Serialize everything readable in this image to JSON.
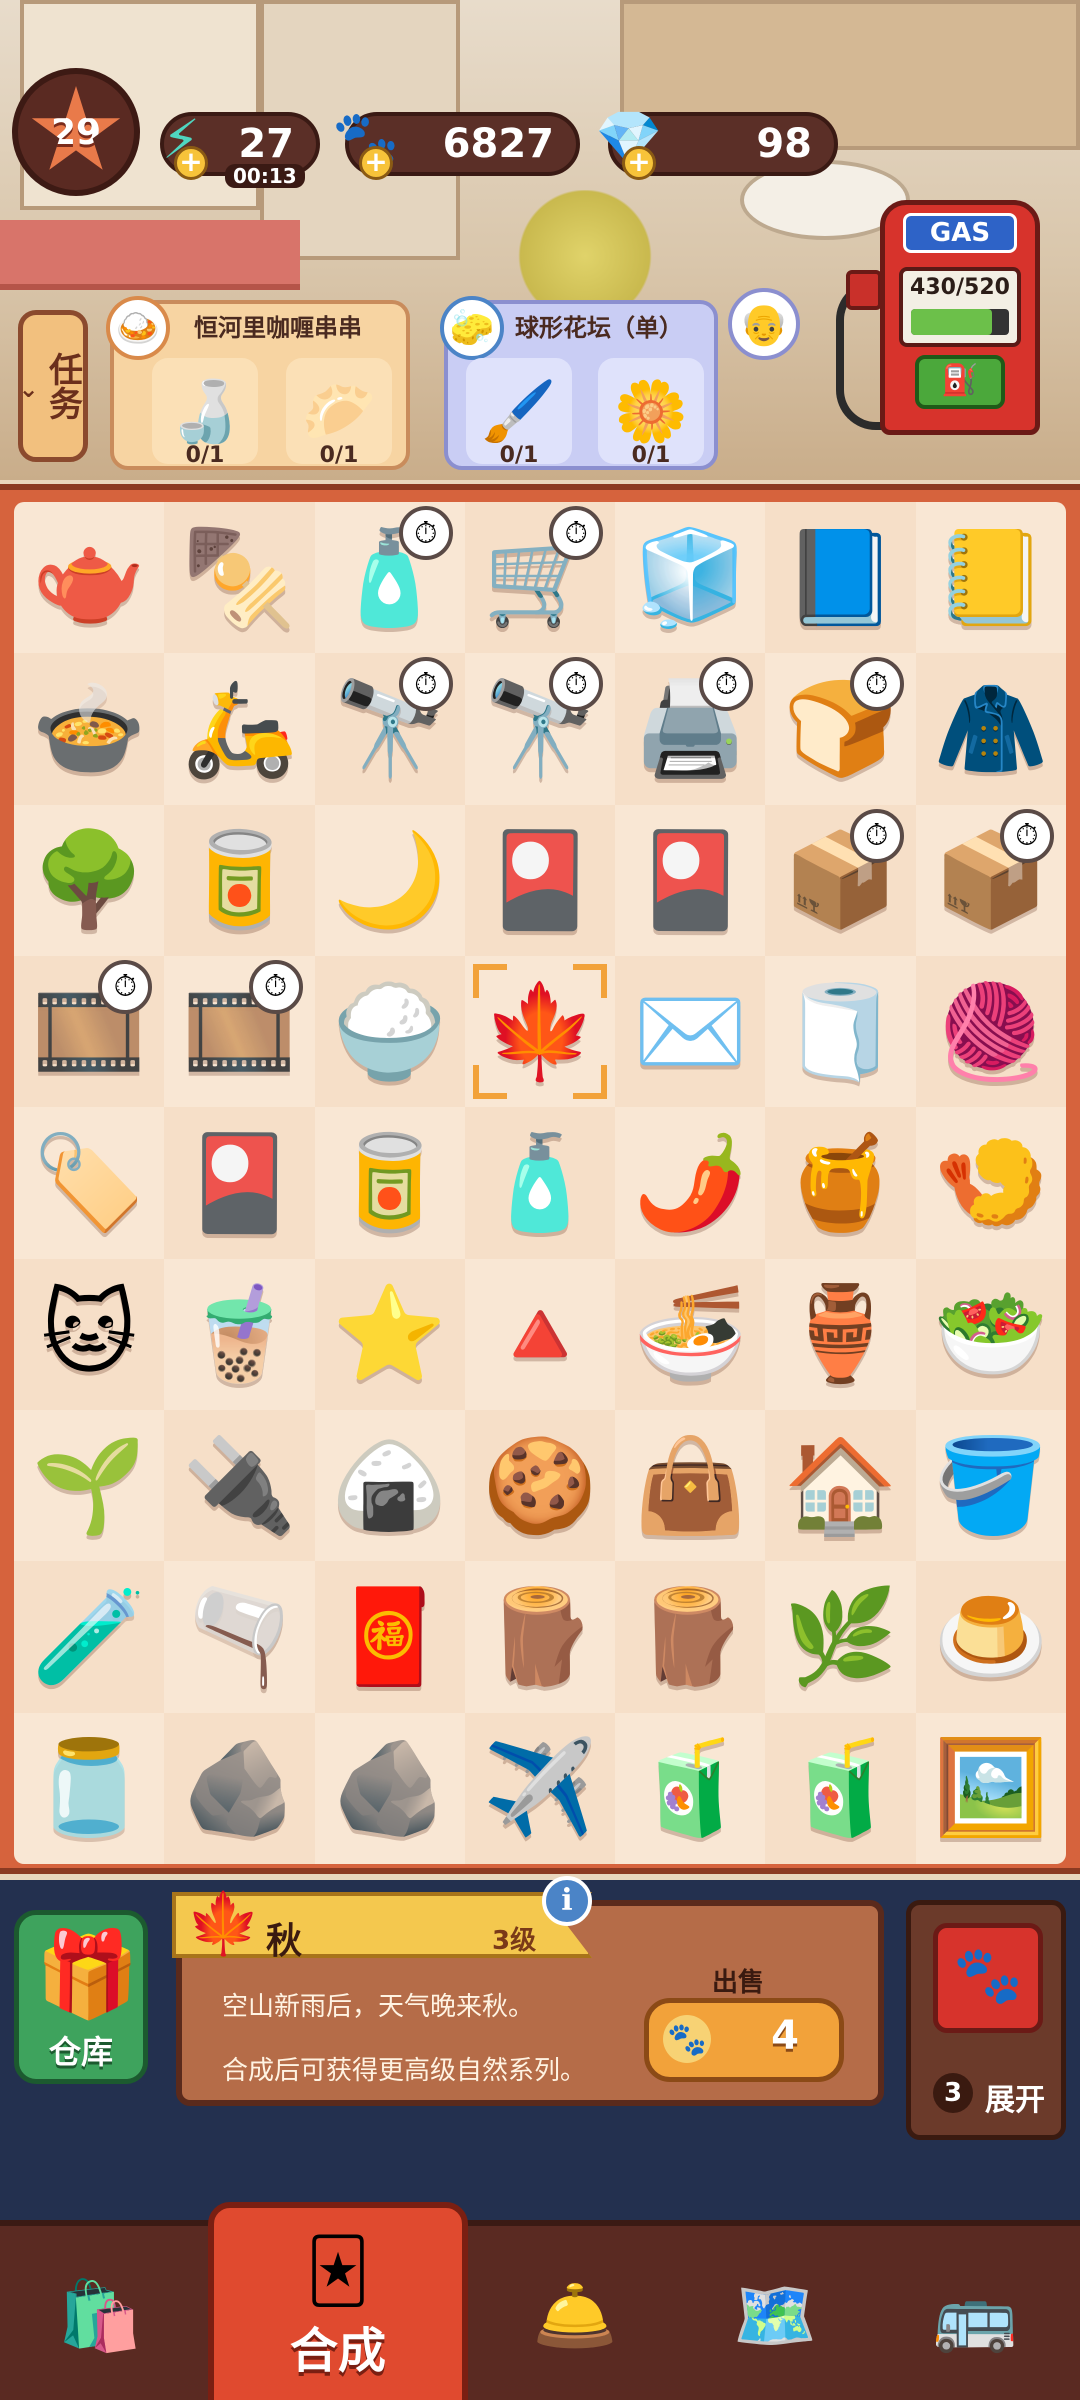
{
  "hud": {
    "level": "29",
    "energy": "27",
    "energy_timer": "00:13",
    "coins": "6827",
    "gems": "98",
    "gas_sign": "GAS",
    "gas_value": "430/520",
    "gas_fill": 0.83
  },
  "tasks": {
    "tab_label": "任务",
    "cards": [
      {
        "title": "恒河里咖喱串串",
        "avatar": "🍛",
        "reqs": [
          {
            "icon": "🍶",
            "count": "0/1"
          },
          {
            "icon": "🥟",
            "count": "0/1"
          }
        ]
      },
      {
        "title": "球形花坛（单）",
        "avatar": "🧽",
        "reqs": [
          {
            "icon": "🖌️",
            "count": "0/1"
          },
          {
            "icon": "🌼",
            "count": "0/1"
          }
        ]
      }
    ],
    "npc": "👴"
  },
  "board": [
    [
      {
        "i": "🫖",
        "c": false
      },
      {
        "i": "🍢",
        "c": false
      },
      {
        "i": "🧴",
        "c": true
      },
      {
        "i": "🛒",
        "c": true
      },
      {
        "i": "🧊",
        "c": false
      },
      {
        "i": "📘",
        "c": false
      },
      {
        "i": "📒",
        "c": false
      }
    ],
    [
      {
        "i": "🍲",
        "c": false
      },
      {
        "i": "🛵",
        "c": false
      },
      {
        "i": "🔭",
        "c": true
      },
      {
        "i": "🔭",
        "c": true
      },
      {
        "i": "🖨️",
        "c": true
      },
      {
        "i": "🍞",
        "c": true
      },
      {
        "i": "🧥",
        "c": false
      }
    ],
    [
      {
        "i": "🌳",
        "c": false
      },
      {
        "i": "🥫",
        "c": false
      },
      {
        "i": "🌙",
        "c": false
      },
      {
        "i": "🎴",
        "c": false
      },
      {
        "i": "🎴",
        "c": false
      },
      {
        "i": "📦",
        "c": true
      },
      {
        "i": "📦",
        "c": true
      }
    ],
    [
      {
        "i": "🎞️",
        "c": true
      },
      {
        "i": "🎞️",
        "c": true
      },
      {
        "i": "🍚",
        "c": false
      },
      {
        "i": "🍁",
        "c": false,
        "sel": true
      },
      {
        "i": "✉️",
        "c": false
      },
      {
        "i": "🧻",
        "c": false
      },
      {
        "i": "🧶",
        "c": false
      }
    ],
    [
      {
        "i": "🏷️",
        "c": false
      },
      {
        "i": "🎴",
        "c": false
      },
      {
        "i": "🥫",
        "c": false
      },
      {
        "i": "🧴",
        "c": false
      },
      {
        "i": "🌶️",
        "c": false
      },
      {
        "i": "🍯",
        "c": false
      },
      {
        "i": "🍤",
        "c": false
      }
    ],
    [
      {
        "i": "🐱",
        "c": false
      },
      {
        "i": "🧋",
        "c": false
      },
      {
        "i": "⭐",
        "c": false
      },
      {
        "i": "🔺",
        "c": false
      },
      {
        "i": "🍜",
        "c": false
      },
      {
        "i": "🏺",
        "c": false
      },
      {
        "i": "🥗",
        "c": false
      }
    ],
    [
      {
        "i": "🌱",
        "c": false
      },
      {
        "i": "🔌",
        "c": false
      },
      {
        "i": "🍙",
        "c": false
      },
      {
        "i": "🍪",
        "c": false
      },
      {
        "i": "👜",
        "c": false
      },
      {
        "i": "🏠",
        "c": false
      },
      {
        "i": "🪣",
        "c": false
      }
    ],
    [
      {
        "i": "🧪",
        "c": false
      },
      {
        "i": "🫗",
        "c": false
      },
      {
        "i": "🧧",
        "c": false
      },
      {
        "i": "🪵",
        "c": false
      },
      {
        "i": "🪵",
        "c": false
      },
      {
        "i": "🌿",
        "c": false
      },
      {
        "i": "🍮",
        "c": false
      }
    ],
    [
      {
        "i": "🫙",
        "c": false
      },
      {
        "i": "🪨",
        "c": false
      },
      {
        "i": "🪨",
        "c": false
      },
      {
        "i": "✈️",
        "c": false
      },
      {
        "i": "🧃",
        "c": false
      },
      {
        "i": "🧃",
        "c": false
      },
      {
        "i": "🖼️",
        "c": false
      }
    ]
  ],
  "info": {
    "warehouse_label": "仓库",
    "name": "秋",
    "level": "3级",
    "desc1": "空山新雨后，天气晚来秋。",
    "desc2": "合成后可获得更高级自然系列。",
    "sell_label": "出售",
    "sell_value": "4",
    "expand_count": "3",
    "expand_label": "展开"
  },
  "nav": {
    "merge_label": "合成"
  }
}
